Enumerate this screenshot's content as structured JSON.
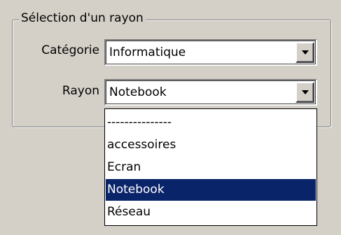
{
  "group": {
    "legend": "Sélection d'un rayon"
  },
  "categorie": {
    "label": "Catégorie",
    "value": "Informatique"
  },
  "rayon": {
    "label": "Rayon",
    "value": "Notebook",
    "options": [
      {
        "label": "---------------",
        "selected": false
      },
      {
        "label": "accessoires",
        "selected": false
      },
      {
        "label": "Ecran",
        "selected": false
      },
      {
        "label": "Notebook",
        "selected": true
      },
      {
        "label": "Réseau",
        "selected": false
      }
    ]
  },
  "colors": {
    "face": "#d4d0c8",
    "selection": "#0a246a",
    "selection_text": "#ffffff"
  }
}
